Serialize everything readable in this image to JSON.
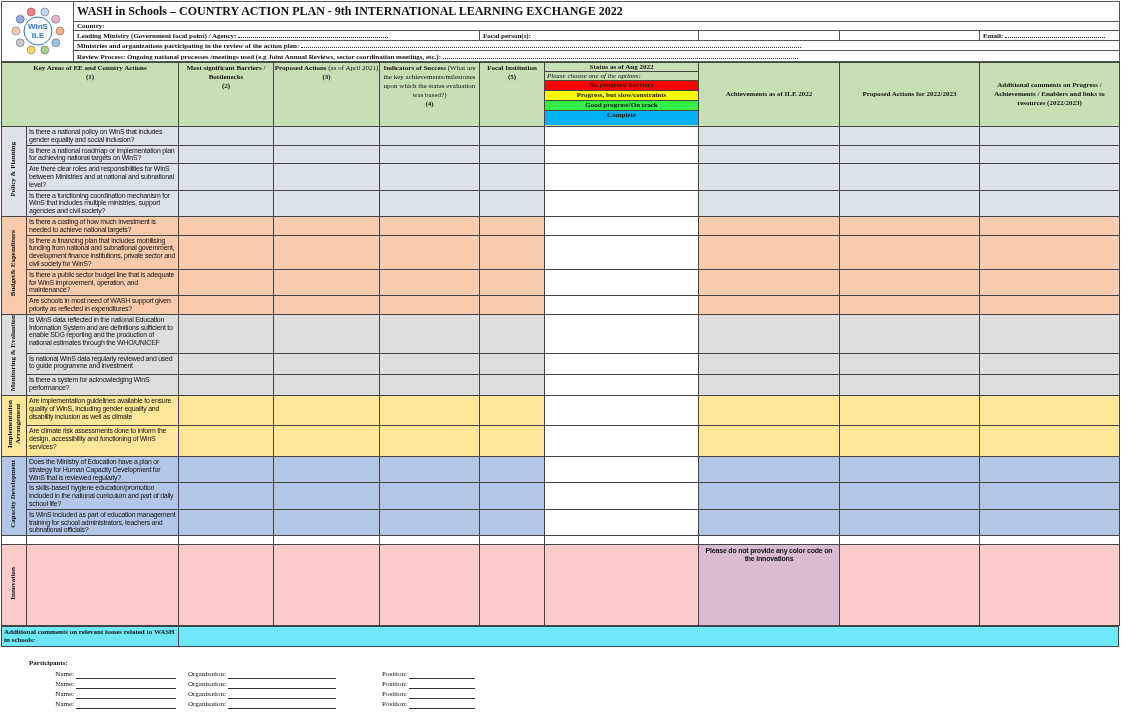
{
  "header": {
    "logo_lines": [
      "WinS",
      "ILE"
    ],
    "title": "WASH in Schools – COUNTRY ACTION PLAN - 9th INTERNATIONAL LEARNING EXCHANGE 2022",
    "country_label": "Country:",
    "agency_label": "Leading Ministry (Government focal point) / Agency:",
    "focal_label": "Focal person(s):",
    "email_label": "Email:",
    "ministries_label": "Ministries and organizations participating in the review of the action plan:",
    "review_label": "Review Process: Ongoing national processes /meetings used (e.g Joint Annual Reviews, sector coordination meetings, etc.):"
  },
  "columns": [
    {
      "kind": "text",
      "label": "Key Areas of EE and Country Actions",
      "number": "(1)"
    },
    {
      "kind": "text",
      "label": "Most significant Barriers / Bottlenecks",
      "number": "(2)"
    },
    {
      "kind": "text",
      "label": "Proposed Actions",
      "note": "(as of April 2021)",
      "number": "(3)"
    },
    {
      "kind": "text",
      "label": "Indicators of Success",
      "note": "(What are the key achievements/milestones upon which the status evaluation was based?)",
      "number": "(4)"
    },
    {
      "kind": "text",
      "label": "Focal Institution",
      "number": "(5)"
    },
    {
      "kind": "status",
      "label": "Status as of Aug 2022",
      "prompt": "Please choose one of the options:",
      "options": [
        {
          "label": "No progress/ barriers",
          "color": "#ff0000"
        },
        {
          "label": "Progress, but slow/constraints",
          "color": "#ffff00"
        },
        {
          "label": "Good progress/On track",
          "color": "#33ee44"
        },
        {
          "label": "Complete",
          "color": "#00b0f0"
        }
      ]
    },
    {
      "kind": "centered",
      "label": "Achievements as of ILE 2022"
    },
    {
      "kind": "centered",
      "label": "Proposed Actions for 2022/2023"
    },
    {
      "kind": "centered",
      "label": "Additional comments on Progress / Achievements / Enablers and links to resources (2022/2023)"
    }
  ],
  "sections": [
    {
      "name": "Policy & Planning",
      "color": "#dce2ea",
      "rows": [
        {
          "question": "Is there a national policy on WinS that includes gender equality and social inclusion?"
        },
        {
          "question": "Is there a national roadmap or implementation plan for achieving national targets on WinS?"
        },
        {
          "question": "Are there clear roles and responsibilities for WinS between Ministries and at national and subnational level?"
        },
        {
          "question": "Is there a functioning coordination mechanism for WinS that includes multiple ministries, support agencies and civil society?"
        }
      ]
    },
    {
      "name": "Budget& Expenditure",
      "color": "#f8cbad",
      "rows": [
        {
          "question": "Is there a costing of how much investment is needed to achieve national targets?"
        },
        {
          "question": "Is there a financing plan that includes mobilising funding from national and subnational government, development finance institutions, private sector and civil society for WinS?"
        },
        {
          "question": "Is there a public sector budget line that is adequate for WinS improvement, operation, and maintenance?"
        },
        {
          "question": "Are schools in most need of WASH support given priority as reflected in expenditures?"
        }
      ]
    },
    {
      "name": "Monitoring & Evaluation",
      "color": "#dedede",
      "rows": [
        {
          "question": "Is WinS data reflected in the national Education Information System and are definitions sufficient to enable SDG reporting and the production of national estimates through the WHO/UNICEF"
        },
        {
          "question": "Is national WinS data regularly reviewed and used to guide programme and investment"
        },
        {
          "question": "Is there a system for acknowledging WinS performance?"
        }
      ]
    },
    {
      "name": "Implementation Arrangement",
      "color": "#ffe699",
      "rows": [
        {
          "question": "Are implementation guidelines available to ensure quality of WinS, including gender equality and disability inclusion as well as climate"
        },
        {
          "question": "Are climate risk assessments done to inform the design, accessibility and functioning of WinS services?"
        }
      ]
    },
    {
      "name": "Capacity Development",
      "color": "#b4c6e7",
      "rows": [
        {
          "question": "Does the Ministry of Education have a plan or strategy for Human Capacity Development for WinS that is reviewed regularly?"
        },
        {
          "question": "Is skills-based hygiene education/promotion included in the national curriculum and part of daily school life?"
        },
        {
          "question": "Is WinS included as part of education management training for school administrators, teachers and subnational officials?"
        }
      ]
    }
  ],
  "innovation": {
    "name": "Innovation",
    "note": "Please do not provide any color code on the innovations"
  },
  "additional_comments": {
    "label": "Additional comments on relevant issues related to WASH in schools:"
  },
  "participants": {
    "title": "Participants:",
    "rows": [
      {
        "name_label": "Name:",
        "organisation_label": "Organisation:",
        "position_label": "Position:"
      },
      {
        "name_label": "Name:",
        "organisation_label": "Organisation:",
        "position_label": "Position:"
      },
      {
        "name_label": "Name:",
        "organisation_label": "Organisation:",
        "position_label": "Position:"
      },
      {
        "name_label": "Name:",
        "organisation_label": "Organisation:",
        "position_label": "Position:"
      }
    ]
  }
}
